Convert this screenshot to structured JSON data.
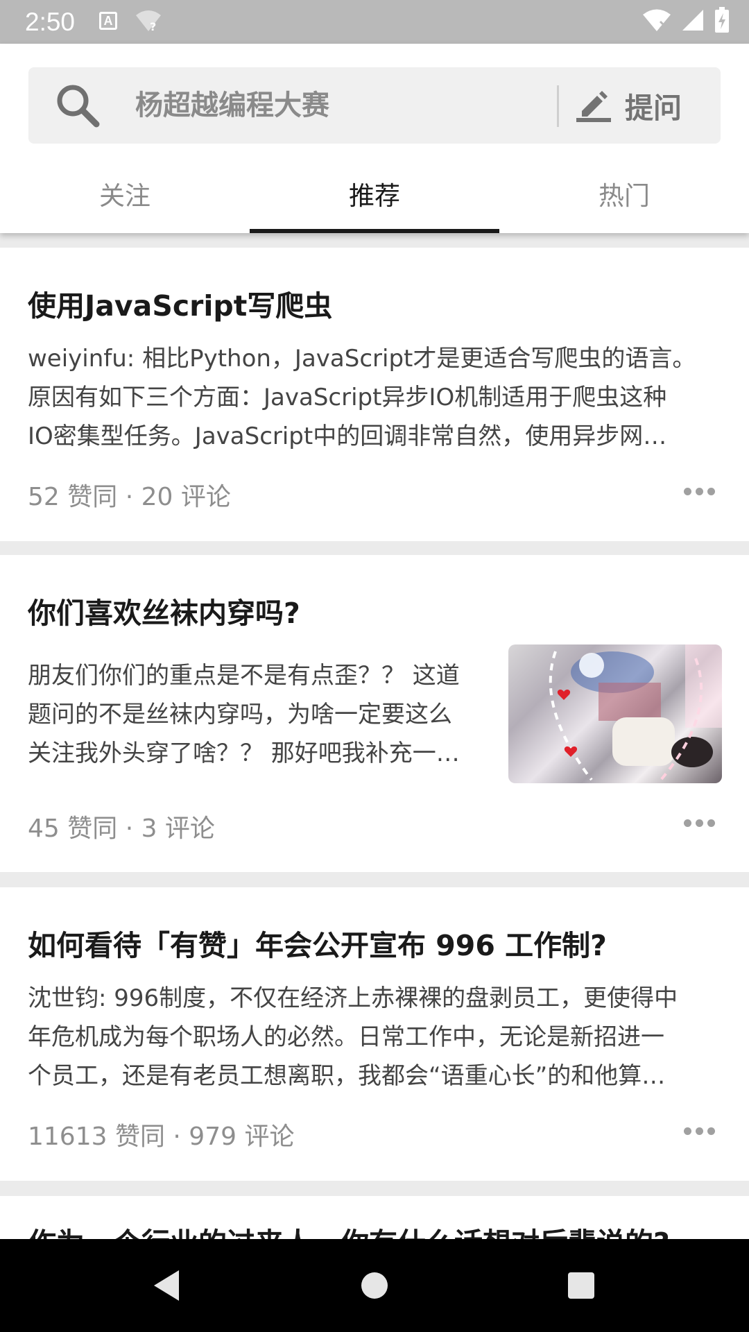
{
  "status_bar": {
    "time": "2:50",
    "a_badge": "A",
    "wifi_badge": "?"
  },
  "search": {
    "placeholder": "杨超越编程大赛",
    "ask_label": "提问"
  },
  "tabs": [
    {
      "label": "关注",
      "active": false
    },
    {
      "label": "推荐",
      "active": true
    },
    {
      "label": "热门",
      "active": false
    }
  ],
  "feed": [
    {
      "title": "使用JavaScript写爬虫",
      "excerpt_lines": [
        "weiyinfu: 相比Python，JavaScript才是更适合写爬虫的语言。",
        "原因有如下三个方面：JavaScript异步IO机制适用于爬虫这种",
        "IO密集型任务。JavaScript中的回调非常自然，使用异步网…"
      ],
      "meta": "52 赞同 · 20 评论",
      "has_image": false
    },
    {
      "title": "你们喜欢丝袜内穿吗?",
      "excerpt_lines": [
        "朋友们你们的重点是不是有点歪？？ 这道",
        "题问的不是丝袜内穿吗，为啥一定要这么",
        "关注我外头穿了啥？？ 那好吧我补充一…"
      ],
      "meta": "45 赞同 · 3 评论",
      "has_image": true
    },
    {
      "title": "如何看待「有赞」年会公开宣布 996 工作制?",
      "excerpt_lines": [
        "沈世钧: 996制度，不仅在经济上赤裸裸的盘剥员工，更使得中",
        "年危机成为每个职场人的必然。日常工作中，无论是新招进一",
        "个员工，还是有老员工想离职，我都会“语重心长”的和他算…"
      ],
      "meta": "11613 赞同 · 979 评论",
      "has_image": false
    },
    {
      "title": "作为一个行业的过来人，你有什么话想对后辈说的?",
      "excerpt_lines": [],
      "meta": "",
      "has_image": false
    }
  ],
  "colors": {
    "status_bar": "#b9b9b9",
    "nav_bar": "#000000",
    "divider": "#ebebeb",
    "active_tab": "#1a1a1a",
    "muted_text": "#8e8e8e"
  }
}
